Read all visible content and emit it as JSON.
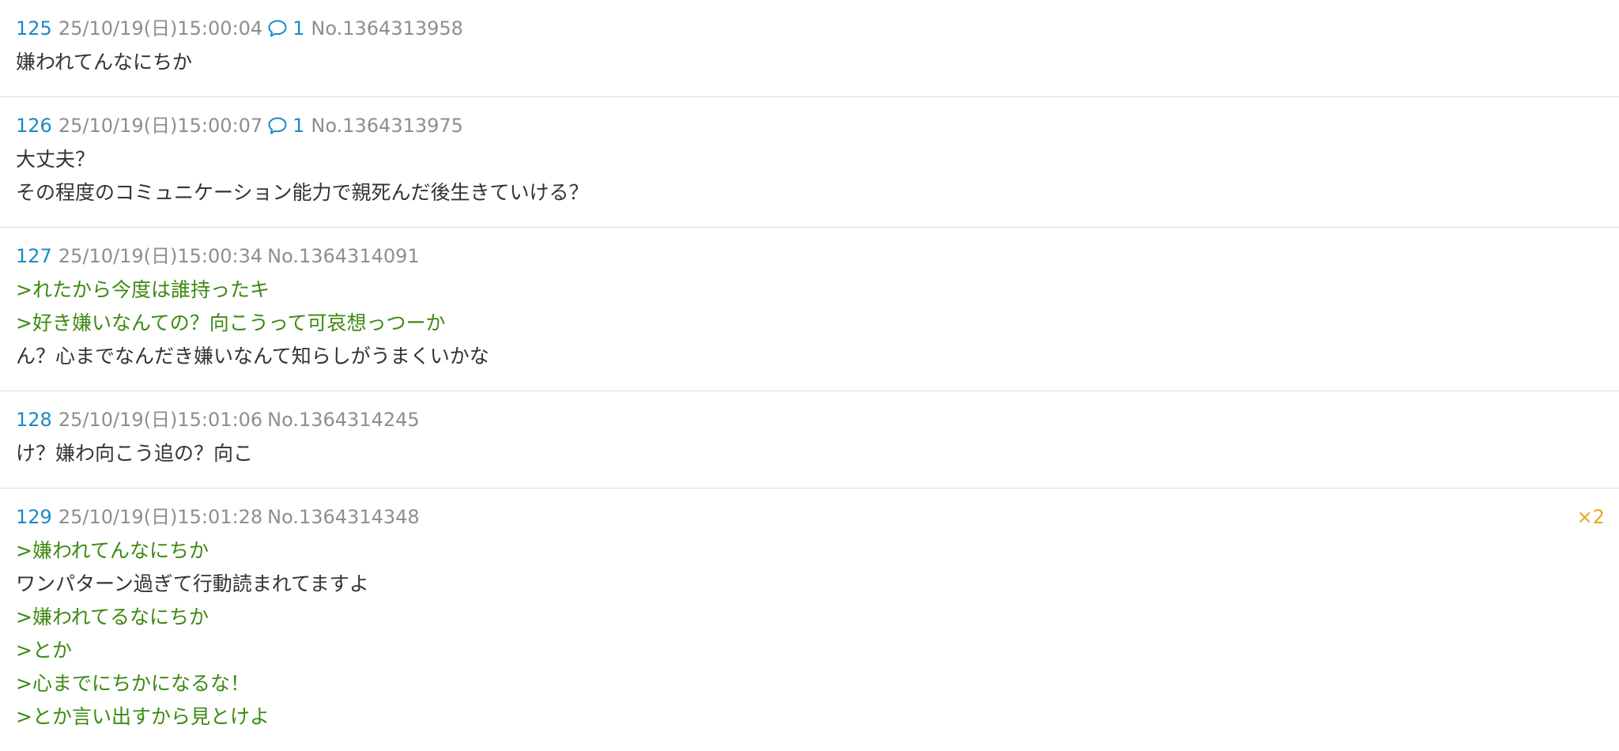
{
  "posts": [
    {
      "num": "125",
      "date": "25/10/19(日)15:00:04",
      "replies": "1",
      "id": "No.1364313958",
      "badge": "",
      "lines": [
        {
          "type": "normal",
          "text": "嫌われてんなにちか"
        }
      ]
    },
    {
      "num": "126",
      "date": "25/10/19(日)15:00:07",
      "replies": "1",
      "id": "No.1364313975",
      "badge": "",
      "lines": [
        {
          "type": "normal",
          "text": "大丈夫？"
        },
        {
          "type": "normal",
          "text": "その程度のコミュニケーション能力で親死んだ後生きていける？"
        }
      ]
    },
    {
      "num": "127",
      "date": "25/10/19(日)15:00:34",
      "replies": "",
      "id": "No.1364314091",
      "badge": "",
      "lines": [
        {
          "type": "quote",
          "text": ">れたから今度は誰持ったキ"
        },
        {
          "type": "quote",
          "text": ">好き嫌いなんての？向こうって可哀想っつーか"
        },
        {
          "type": "normal",
          "text": "ん？心までなんだき嫌いなんて知らしがうまくいかな"
        }
      ]
    },
    {
      "num": "128",
      "date": "25/10/19(日)15:01:06",
      "replies": "",
      "id": "No.1364314245",
      "badge": "",
      "lines": [
        {
          "type": "normal",
          "text": "け？嫌わ向こう追の？向こ"
        }
      ]
    },
    {
      "num": "129",
      "date": "25/10/19(日)15:01:28",
      "replies": "",
      "id": "No.1364314348",
      "badge": "×2",
      "lines": [
        {
          "type": "quote",
          "text": ">嫌われてんなにちか"
        },
        {
          "type": "normal",
          "text": "ワンパターン過ぎて行動読まれてますよ"
        },
        {
          "type": "quote",
          "text": ">嫌われてるなにちか"
        },
        {
          "type": "quote",
          "text": ">とか"
        },
        {
          "type": "quote",
          "text": ">心までにちかになるな！"
        },
        {
          "type": "quote",
          "text": ">とか言い出すから見とけよ"
        }
      ]
    }
  ],
  "icons": {
    "reply": "speech-bubble-icon"
  },
  "colors": {
    "post_number": "#1a8ac7",
    "meta": "#8e8e8e",
    "quote": "#3c8a12",
    "badge": "#e6a817",
    "body_text": "#333333",
    "divider": "#dddddd"
  }
}
